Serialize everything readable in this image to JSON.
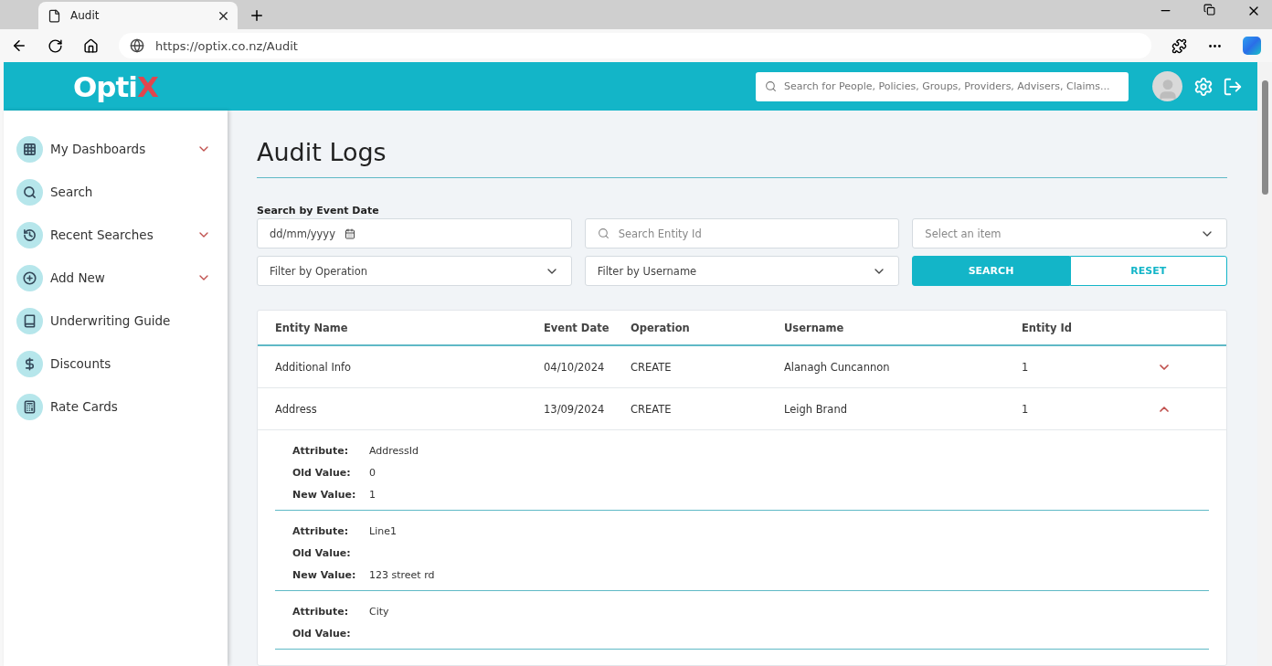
{
  "browser": {
    "tab": {
      "title": "Audit"
    },
    "url": "https://optix.co.nz/Audit"
  },
  "header": {
    "logo_text": "Opti",
    "logo_accent": "X",
    "search": {
      "placeholder": "Search for People, Policies, Groups, Providers, Advisers, Claims..."
    }
  },
  "sidebar": {
    "items": [
      {
        "kind": "grid",
        "label": "My Dashboards",
        "expandable": true
      },
      {
        "kind": "search",
        "label": "Search",
        "expandable": false
      },
      {
        "kind": "history",
        "label": "Recent Searches",
        "expandable": true
      },
      {
        "kind": "add",
        "label": "Add New",
        "expandable": true
      },
      {
        "kind": "book",
        "label": "Underwriting Guide",
        "expandable": false
      },
      {
        "kind": "dollar",
        "label": "Discounts",
        "expandable": false
      },
      {
        "kind": "calculator",
        "label": "Rate Cards",
        "expandable": false
      }
    ]
  },
  "page": {
    "title": "Audit Logs"
  },
  "filters": {
    "date_label": "Search by Event Date",
    "date": {
      "placeholder": "dd/mm/yyyy"
    },
    "entity_id": {
      "placeholder": "Search Entity Id"
    },
    "item_select": {
      "placeholder": "Select an item"
    },
    "operation": {
      "placeholder": "Filter by Operation"
    },
    "username": {
      "placeholder": "Filter by Username"
    },
    "buttons": [
      {
        "label": "SEARCH",
        "kind": "primary"
      },
      {
        "label": "RESET",
        "kind": "outline"
      }
    ]
  },
  "table": {
    "columns": [
      "Entity Name",
      "Event Date",
      "Operation",
      "Username",
      "Entity Id"
    ],
    "rows": [
      {
        "cells": [
          "Additional Info",
          "04/10/2024",
          "CREATE",
          "Alanagh Cuncannon",
          "1"
        ],
        "expanded": false
      },
      {
        "cells": [
          "Address",
          "13/09/2024",
          "CREATE",
          "Leigh Brand",
          "1"
        ],
        "expanded": true,
        "details": [
          [
            {
              "label": "Attribute:",
              "value": "AddressId"
            },
            {
              "label": "Old Value:",
              "value": "0"
            },
            {
              "label": "New Value:",
              "value": "1"
            }
          ],
          [
            {
              "label": "Attribute:",
              "value": "Line1"
            },
            {
              "label": "Old Value:"
            },
            {
              "label": "New Value:",
              "value": "123 street rd"
            }
          ],
          [
            {
              "label": "Attribute:",
              "value": "City"
            },
            {
              "label": "Old Value:"
            }
          ]
        ]
      }
    ]
  }
}
